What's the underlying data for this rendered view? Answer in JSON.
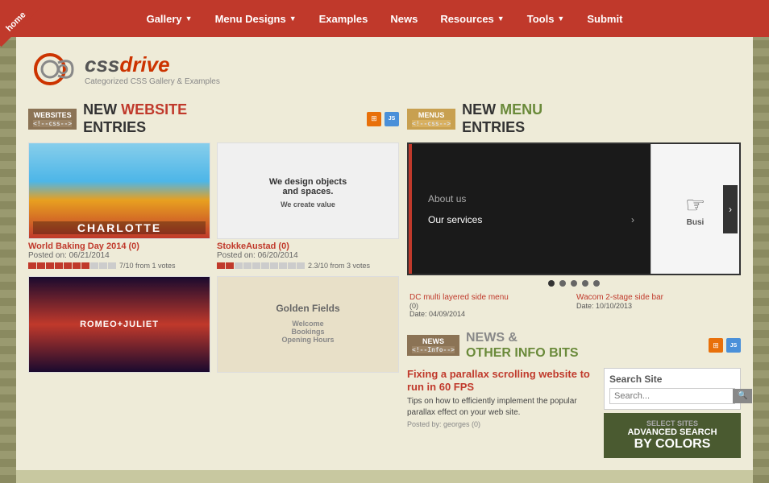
{
  "nav": {
    "items": [
      {
        "label": "Gallery",
        "hasDropdown": true
      },
      {
        "label": "Menu Designs",
        "hasDropdown": true
      },
      {
        "label": "Examples",
        "hasDropdown": false
      },
      {
        "label": "News",
        "hasDropdown": false
      },
      {
        "label": "Resources",
        "hasDropdown": true
      },
      {
        "label": "Tools",
        "hasDropdown": true
      },
      {
        "label": "Submit",
        "hasDropdown": false
      }
    ],
    "home_label": "home"
  },
  "logo": {
    "brand_prefix": "drive",
    "tagline": "Categorized CSS Gallery & Examples"
  },
  "websites_section": {
    "badge": "WEBSITES",
    "badge_sub": "<!--css-->",
    "title_new": "NEW ",
    "title_highlight": "WEBSITE",
    "title_rest": "\nENTRIES",
    "entries": [
      {
        "title": "World Baking Day 2014 (0)",
        "date": "Posted on: 06/21/2014",
        "rating": "7/10 from 1 votes",
        "filled": 7,
        "total": 10,
        "theme": "charlotte"
      },
      {
        "title": "StokkeAustad (0)",
        "date": "Posted on: 06/20/2014",
        "rating": "2.3/10 from 3 votes",
        "filled": 2,
        "total": 10,
        "theme": "stokke"
      },
      {
        "title": "Romeo Juliet",
        "date": "",
        "theme": "romeo"
      },
      {
        "title": "Golden Fields",
        "date": "",
        "theme": "golden"
      }
    ]
  },
  "menus_section": {
    "badge": "MENUS",
    "badge_sub": "<!--css-->",
    "title_new": "NEW ",
    "title_highlight": "MENU",
    "title_rest": "\nENTRIES",
    "carousel_items": [
      {
        "label": "About us"
      },
      {
        "label": "Our services",
        "has_arrow": true
      }
    ],
    "carousel_right_text": "Busi",
    "entries": [
      {
        "title": "DC multi layered side menu",
        "score": "(0)",
        "date": "Date: 04/09/2014"
      },
      {
        "title": "Wacom 2-stage side bar",
        "score": "",
        "date": "Date: 10/10/2013"
      }
    ],
    "dots": 5,
    "active_dot": 0
  },
  "news_section": {
    "badge": "NEWS",
    "badge_sub": "<!--Info-->",
    "title": "NEWS &\nOTHER INFO BITS",
    "items": [
      {
        "title": "Fixing a parallax scrolling website to run in 60 FPS",
        "desc": "Tips on how to efficiently implement the popular parallax effect on your web site.",
        "meta": "Posted by: georges (0)"
      }
    ]
  },
  "search": {
    "title": "Search Site",
    "placeholder": "Search...",
    "btn_label": "🔍",
    "advanced_label": "ADVANCED SEARCH",
    "advanced_sub": "BY COLORS",
    "select_label": "SELECT SITES"
  }
}
